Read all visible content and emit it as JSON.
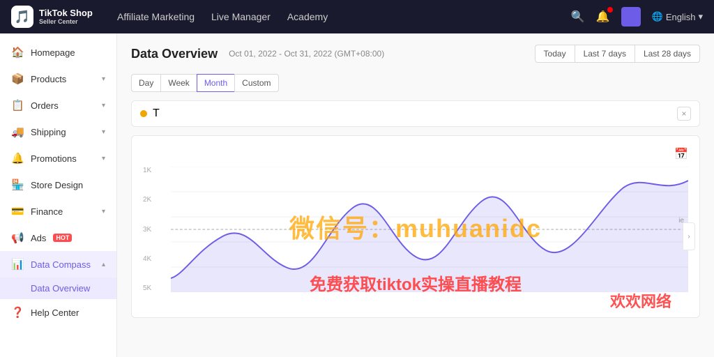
{
  "topnav": {
    "logo": {
      "icon": "🎵",
      "line1": "TikTok Shop",
      "line2": "Seller Center"
    },
    "nav_links": [
      {
        "label": "Affiliate Marketing",
        "active": false
      },
      {
        "label": "Live Manager",
        "active": false
      },
      {
        "label": "Academy",
        "active": false
      }
    ],
    "lang": "English"
  },
  "sidebar": {
    "items": [
      {
        "id": "homepage",
        "label": "Homepage",
        "icon": "🏠",
        "has_chevron": false,
        "active": false
      },
      {
        "id": "products",
        "label": "Products",
        "icon": "📦",
        "has_chevron": true,
        "active": false
      },
      {
        "id": "orders",
        "label": "Orders",
        "icon": "📋",
        "has_chevron": true,
        "active": false
      },
      {
        "id": "shipping",
        "label": "Shipping",
        "icon": "🚚",
        "has_chevron": true,
        "active": false
      },
      {
        "id": "promotions",
        "label": "Promotions",
        "icon": "🔔",
        "has_chevron": true,
        "active": false
      },
      {
        "id": "store-design",
        "label": "Store Design",
        "icon": "🏪",
        "has_chevron": false,
        "active": false
      },
      {
        "id": "finance",
        "label": "Finance",
        "icon": "💳",
        "has_chevron": true,
        "active": false
      },
      {
        "id": "ads",
        "label": "Ads",
        "icon": "📢",
        "has_chevron": false,
        "hot": true,
        "active": false
      },
      {
        "id": "data-compass",
        "label": "Data Compass",
        "icon": "📊",
        "has_chevron": true,
        "active": true
      },
      {
        "id": "help-center",
        "label": "Help Center",
        "icon": "❓",
        "has_chevron": false,
        "active": false
      }
    ],
    "sub_items": [
      {
        "label": "Data Overview",
        "active": true,
        "parent": "data-compass"
      }
    ]
  },
  "main": {
    "page_title": "Data Overview",
    "date_range": "Oct 01, 2022 - Oct 31, 2022 (GMT+08:00)",
    "time_filters": [
      {
        "label": "Today",
        "active": false
      },
      {
        "label": "Last 7 days",
        "active": false
      },
      {
        "label": "Last 28 days",
        "active": false
      }
    ],
    "granularity_filters": [
      {
        "label": "Day",
        "active": false
      },
      {
        "label": "Week",
        "active": false
      },
      {
        "label": "Month",
        "active": true
      },
      {
        "label": "Custom",
        "active": false
      }
    ],
    "metric_dot_color": "#f0a500",
    "metric_label": "T",
    "close_icon": "×",
    "chart": {
      "y_labels": [
        "5K",
        "4K",
        "3K",
        "2K",
        "1K"
      ],
      "reference_line_label": "ie",
      "expand_icon": "›"
    },
    "watermark_text": "微信号：muhuanidc",
    "watermark2_text": "欢欢网络",
    "watermark3_text": "免费获取tiktok实操直播教程"
  }
}
